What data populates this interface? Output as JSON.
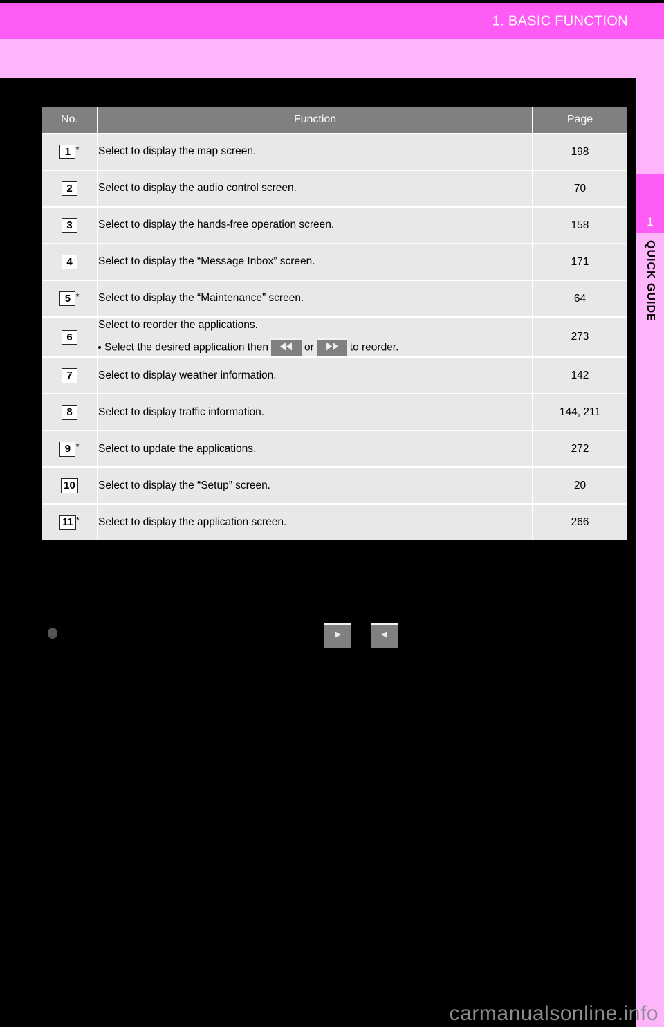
{
  "header": {
    "chapter_title": "1. BASIC FUNCTION"
  },
  "sidebar": {
    "chapter_number": "1",
    "section_label": "QUICK GUIDE"
  },
  "table": {
    "columns": [
      "No.",
      "Function",
      "Page"
    ],
    "rows": [
      {
        "no": "1",
        "star": "*",
        "function": "Select to display the map screen.",
        "page": "198"
      },
      {
        "no": "2",
        "star": "",
        "function": "Select to display the audio control screen.",
        "page": "70"
      },
      {
        "no": "3",
        "star": "",
        "function": "Select to display the hands-free operation screen.",
        "page": "158"
      },
      {
        "no": "4",
        "star": "",
        "function": "Select to display the “Message Inbox” screen.",
        "page": "171"
      },
      {
        "no": "5",
        "star": "*",
        "function": "Select to display the “Maintenance” screen.",
        "page": "64"
      },
      {
        "no": "6",
        "star": "",
        "function": "Select to reorder the applications.",
        "subline_before": "Select the desired application then",
        "subline_middle": "or",
        "subline_after": "to reorder.",
        "page": "273"
      },
      {
        "no": "7",
        "star": "",
        "function": "Select to display weather information.",
        "page": "142"
      },
      {
        "no": "8",
        "star": "",
        "function": "Select to display traffic information.",
        "page": "144, 211"
      },
      {
        "no": "9",
        "star": "*",
        "function": "Select to update the applications.",
        "page": "272"
      },
      {
        "no": "10",
        "star": "",
        "function": "Select to display the “Setup” screen.",
        "page": "20"
      },
      {
        "no": "11",
        "star": "*",
        "function": "Select to display the application screen.",
        "page": "266"
      }
    ]
  },
  "note": {
    "text_before": "",
    "text_middle": "",
    "text_after": ""
  },
  "watermark": {
    "text": "carmanualsonline.info"
  },
  "colors": {
    "banner_pink": "#FF5CF5",
    "band_light_pink": "#FFB5FB",
    "page_background": "#000000",
    "table_header_gray": "#808080",
    "table_body_gray": "#E8E8E8",
    "key_button_gray": "#808080",
    "watermark_gray": "#8C8C8C"
  }
}
